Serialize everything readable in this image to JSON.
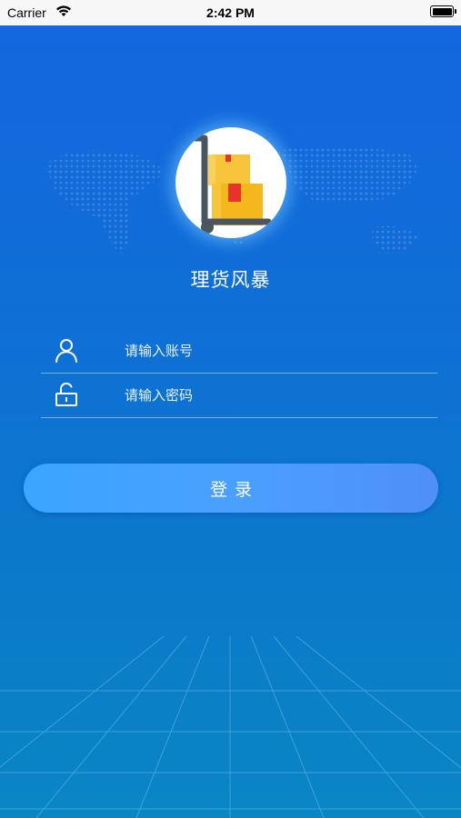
{
  "status_bar": {
    "carrier": "Carrier",
    "time": "2:42 PM",
    "icons": [
      "wifi-icon",
      "battery-icon"
    ]
  },
  "app": {
    "title": "理货风暴",
    "logo_icon": "hand-truck-boxes-icon"
  },
  "login_form": {
    "account": {
      "placeholder": "请输入账号",
      "value": "",
      "icon": "user-icon"
    },
    "password": {
      "placeholder": "请输入密码",
      "value": "",
      "icon": "lock-icon"
    },
    "submit_label": "登录"
  },
  "colors": {
    "background_top": "#1466e0",
    "background_bottom": "#0a86c5",
    "button_start": "#3aa6ff",
    "button_end": "#4f8ff7",
    "logo_box": "#f5b81c",
    "logo_tag": "#e8332a",
    "logo_cart": "#4a5560"
  }
}
